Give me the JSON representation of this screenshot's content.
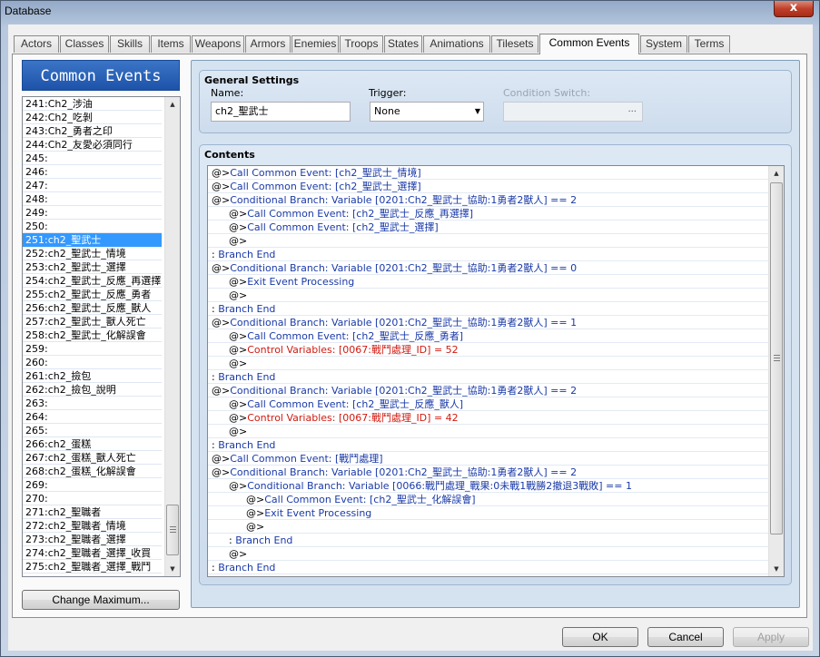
{
  "window": {
    "title": "Database",
    "close_label": "x"
  },
  "tabs": [
    {
      "label": "Actors"
    },
    {
      "label": "Classes"
    },
    {
      "label": "Skills"
    },
    {
      "label": "Items"
    },
    {
      "label": "Weapons"
    },
    {
      "label": "Armors"
    },
    {
      "label": "Enemies"
    },
    {
      "label": "Troops"
    },
    {
      "label": "States"
    },
    {
      "label": "Animations"
    },
    {
      "label": "Tilesets"
    },
    {
      "label": "Common Events"
    },
    {
      "label": "System"
    },
    {
      "label": "Terms"
    }
  ],
  "active_tab": "Common Events",
  "left_panel": {
    "header": "Common Events",
    "selected": "251:ch2_聖武士",
    "items": [
      "241:Ch2_涉油",
      "242:Ch2_吃剝",
      "243:Ch2_勇者之印",
      "244:Ch2_友愛必須同行",
      "245:",
      "246:",
      "247:",
      "248:",
      "249:",
      "250:",
      "251:ch2_聖武士",
      "252:ch2_聖武士_情境",
      "253:ch2_聖武士_選擇",
      "254:ch2_聖武士_反應_再選擇",
      "255:ch2_聖武士_反應_勇者",
      "256:ch2_聖武士_反應_獸人",
      "257:ch2_聖武士_獸人死亡",
      "258:ch2_聖武士_化解誤會",
      "259:",
      "260:",
      "261:ch2_撿包",
      "262:ch2_撿包_說明",
      "263:",
      "264:",
      "265:",
      "266:ch2_蛋糕",
      "267:ch2_蛋糕_獸人死亡",
      "268:ch2_蛋糕_化解誤會",
      "269:",
      "270:",
      "271:ch2_聖職者",
      "272:ch2_聖職者_情境",
      "273:ch2_聖職者_選擇",
      "274:ch2_聖職者_選擇_收買",
      "275:ch2_聖職者_選擇_戰鬥"
    ],
    "change_max_label": "Change Maximum..."
  },
  "general_settings": {
    "title": "General Settings",
    "name_label": "Name:",
    "name_value": "ch2_聖武士",
    "trigger_label": "Trigger:",
    "trigger_value": "None",
    "switch_label": "Condition Switch:",
    "switch_btn": "..."
  },
  "contents": {
    "title": "Contents",
    "lines": [
      {
        "prefix": "@>",
        "text": "Call Common Event: [ch2_聖武士_情境]",
        "indent": 0,
        "color": "blue"
      },
      {
        "prefix": "@>",
        "text": "Call Common Event: [ch2_聖武士_選擇]",
        "indent": 0,
        "color": "blue"
      },
      {
        "prefix": "@>",
        "text": "Conditional Branch: Variable [0201:Ch2_聖武士_協助:1勇者2獸人] == 2",
        "indent": 0,
        "color": "blue"
      },
      {
        "prefix": "@>",
        "text": "Call Common Event: [ch2_聖武士_反應_再選擇]",
        "indent": 1,
        "color": "blue"
      },
      {
        "prefix": "@>",
        "text": "Call Common Event: [ch2_聖武士_選擇]",
        "indent": 1,
        "color": "blue"
      },
      {
        "prefix": "@>",
        "text": "",
        "indent": 1,
        "color": "black"
      },
      {
        "prefix": " : ",
        "text": "Branch End",
        "indent": 0,
        "color": "blue"
      },
      {
        "prefix": "@>",
        "text": "Conditional Branch: Variable [0201:Ch2_聖武士_協助:1勇者2獸人] == 0",
        "indent": 0,
        "color": "blue"
      },
      {
        "prefix": "@>",
        "text": "Exit Event Processing",
        "indent": 1,
        "color": "blue"
      },
      {
        "prefix": "@>",
        "text": "",
        "indent": 1,
        "color": "black"
      },
      {
        "prefix": " : ",
        "text": "Branch End",
        "indent": 0,
        "color": "blue"
      },
      {
        "prefix": "@>",
        "text": "Conditional Branch: Variable [0201:Ch2_聖武士_協助:1勇者2獸人] == 1",
        "indent": 0,
        "color": "blue"
      },
      {
        "prefix": "@>",
        "text": "Call Common Event: [ch2_聖武士_反應_勇者]",
        "indent": 1,
        "color": "blue"
      },
      {
        "prefix": "@>",
        "text": "Control Variables: [0067:戰鬥處理_ID] = 52",
        "indent": 1,
        "color": "red"
      },
      {
        "prefix": "@>",
        "text": "",
        "indent": 1,
        "color": "black"
      },
      {
        "prefix": " : ",
        "text": "Branch End",
        "indent": 0,
        "color": "blue"
      },
      {
        "prefix": "@>",
        "text": "Conditional Branch: Variable [0201:Ch2_聖武士_協助:1勇者2獸人] == 2",
        "indent": 0,
        "color": "blue"
      },
      {
        "prefix": "@>",
        "text": "Call Common Event: [ch2_聖武士_反應_獸人]",
        "indent": 1,
        "color": "blue"
      },
      {
        "prefix": "@>",
        "text": "Control Variables: [0067:戰鬥處理_ID] = 42",
        "indent": 1,
        "color": "red"
      },
      {
        "prefix": "@>",
        "text": "",
        "indent": 1,
        "color": "black"
      },
      {
        "prefix": " : ",
        "text": "Branch End",
        "indent": 0,
        "color": "blue"
      },
      {
        "prefix": "@>",
        "text": "Call Common Event: [戰鬥處理]",
        "indent": 0,
        "color": "blue"
      },
      {
        "prefix": "@>",
        "text": "Conditional Branch: Variable [0201:Ch2_聖武士_協助:1勇者2獸人] == 2",
        "indent": 0,
        "color": "blue"
      },
      {
        "prefix": "@>",
        "text": "Conditional Branch: Variable [0066:戰鬥處理_戰果:0未戰1戰勝2撤退3戰敗] == 1",
        "indent": 1,
        "color": "blue"
      },
      {
        "prefix": "@>",
        "text": "Call Common Event: [ch2_聖武士_化解誤會]",
        "indent": 2,
        "color": "blue"
      },
      {
        "prefix": "@>",
        "text": "Exit Event Processing",
        "indent": 2,
        "color": "blue"
      },
      {
        "prefix": "@>",
        "text": "",
        "indent": 2,
        "color": "black"
      },
      {
        "prefix": " : ",
        "text": "Branch End",
        "indent": 1,
        "color": "blue"
      },
      {
        "prefix": "@>",
        "text": "",
        "indent": 1,
        "color": "black"
      },
      {
        "prefix": " : ",
        "text": "Branch End",
        "indent": 0,
        "color": "blue"
      }
    ]
  },
  "footer": {
    "ok": "OK",
    "cancel": "Cancel",
    "apply": "Apply"
  },
  "colors": {
    "selection": "#3399ff",
    "command_blue": "#1a3aa8",
    "command_red": "#d01a10",
    "header_blue": "#1d53a9"
  }
}
